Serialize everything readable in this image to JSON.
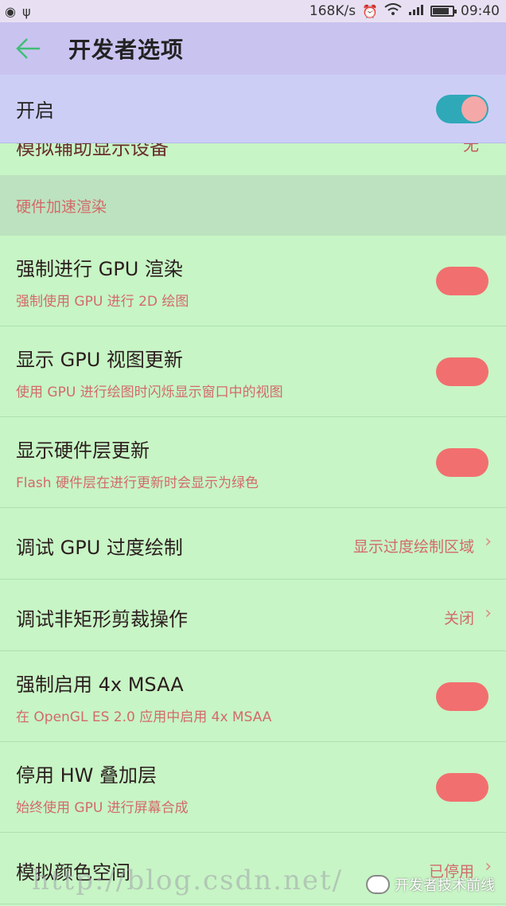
{
  "status_bar": {
    "speed": "168K/s",
    "time": "09:40",
    "left_icons": [
      "notification-icon",
      "usb-icon"
    ],
    "right_icons": [
      "alarm-icon",
      "wifi-icon",
      "signal-icon",
      "battery-icon"
    ]
  },
  "app_bar": {
    "title": "开发者选项",
    "back_icon": "back-arrow-icon"
  },
  "master_switch": {
    "label": "开启",
    "state": "on"
  },
  "clipped_item": {
    "title": "模拟辅助显示设备",
    "value": "无"
  },
  "section_header": "硬件加速渲染",
  "rows": [
    {
      "title": "强制进行 GPU 渲染",
      "subtitle": "强制使用 GPU 进行 2D 绘图",
      "control": "toggle",
      "state": "off"
    },
    {
      "title": "显示 GPU 视图更新",
      "subtitle": "使用 GPU 进行绘图时闪烁显示窗口中的视图",
      "control": "toggle",
      "state": "off"
    },
    {
      "title": "显示硬件层更新",
      "subtitle": "Flash 硬件层在进行更新时会显示为绿色",
      "control": "toggle",
      "state": "off"
    },
    {
      "title": "调试 GPU 过度绘制",
      "value": "显示过度绘制区域",
      "control": "chevron"
    },
    {
      "title": "调试非矩形剪裁操作",
      "value": "关闭",
      "control": "chevron"
    },
    {
      "title": "强制启用 4x MSAA",
      "subtitle": "在 OpenGL ES 2.0 应用中启用 4x MSAA",
      "control": "toggle",
      "state": "off"
    },
    {
      "title": "停用 HW 叠加层",
      "subtitle": "始终使用 GPU 进行屏幕合成",
      "control": "toggle",
      "state": "off"
    },
    {
      "title": "模拟颜色空间",
      "value": "已停用",
      "control": "chevron"
    }
  ],
  "watermark": {
    "url_text": "http://blog.csdn.net/",
    "brand": "开发者技术前线"
  },
  "colors": {
    "background": "#c7f5c5",
    "app_bar": "#c9c3f0",
    "toggle_on_track": "#2fa9b8",
    "toggle_off_track": "#f26f6f",
    "subtitle": "#d36a6a"
  }
}
